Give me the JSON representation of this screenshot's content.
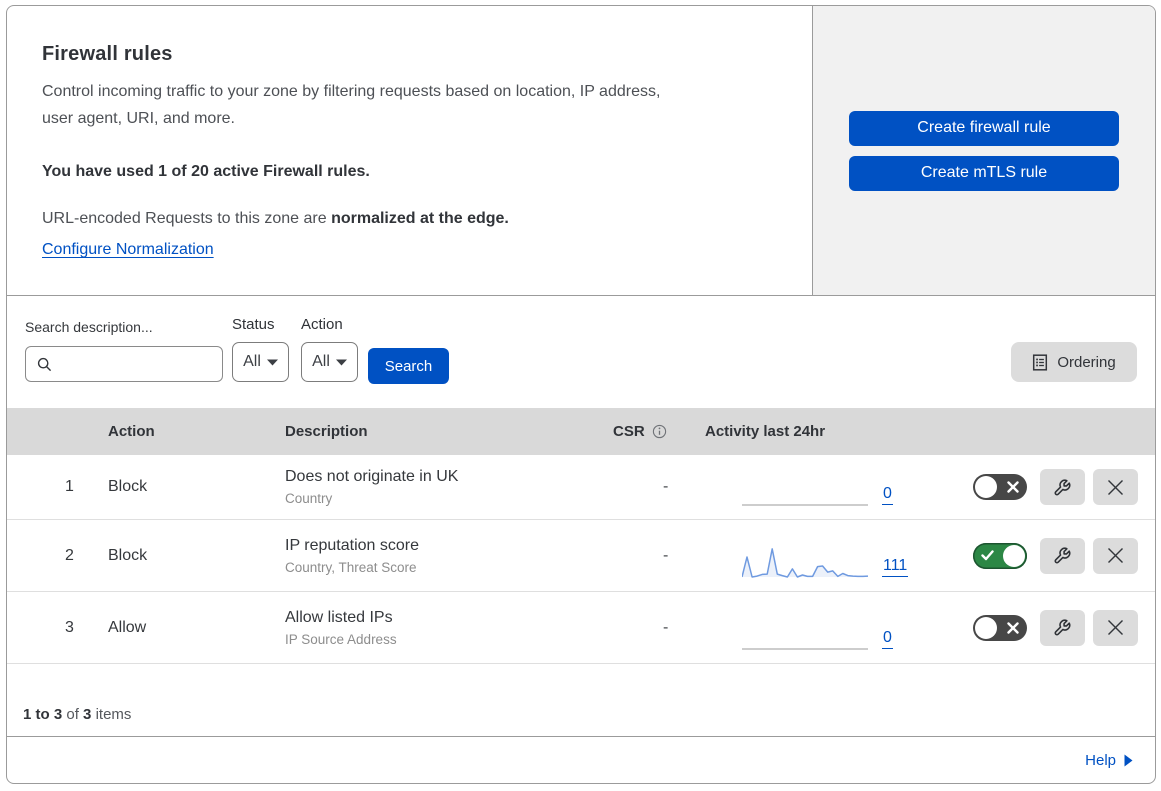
{
  "intro": {
    "title": "Firewall rules",
    "description": "Control incoming traffic to your zone by filtering requests based on location, IP address, user agent, URI, and more.",
    "usage": "You have used 1 of 20 active Firewall rules.",
    "normalization_prefix": "URL-encoded Requests to this zone are ",
    "normalization_bold": "normalized at the edge.",
    "normalization_link": "Configure Normalization"
  },
  "actions_panel": {
    "create_firewall_label": "Create firewall rule",
    "create_mtls_label": "Create mTLS rule"
  },
  "filters": {
    "search_label": "Search description...",
    "search_value": "",
    "status_label": "Status",
    "status_value": "All",
    "action_label": "Action",
    "action_value": "All",
    "search_button": "Search",
    "ordering_button": "Ordering"
  },
  "table": {
    "headers": {
      "action": "Action",
      "description": "Description",
      "csr": "CSR",
      "activity": "Activity last 24hr"
    },
    "rows": [
      {
        "num": "1",
        "action": "Block",
        "description": "Does not originate in UK",
        "fields": "Country",
        "csr": "-",
        "count": "0",
        "enabled": false,
        "sparkline": null
      },
      {
        "num": "2",
        "action": "Block",
        "description": "IP reputation score",
        "fields": "Country, Threat Score",
        "csr": "-",
        "count": "111",
        "enabled": true,
        "sparkline": [
          0,
          69,
          0,
          3,
          9,
          10,
          97,
          10,
          5,
          0,
          28,
          0,
          7,
          2,
          2,
          36,
          38,
          17,
          21,
          2,
          12,
          5,
          3,
          2,
          2,
          3
        ]
      },
      {
        "num": "3",
        "action": "Allow",
        "description": "Allow listed IPs",
        "fields": "IP Source Address",
        "csr": "-",
        "count": "0",
        "enabled": false,
        "sparkline": null
      }
    ]
  },
  "chart_data": {
    "type": "area",
    "title": "Activity last 24hr sparkline (rule 2)",
    "values": [
      0,
      69,
      0,
      3,
      9,
      10,
      97,
      10,
      5,
      0,
      28,
      0,
      7,
      2,
      2,
      36,
      38,
      17,
      21,
      2,
      12,
      5,
      3,
      2,
      2,
      3
    ],
    "ylim": [
      0,
      100
    ]
  },
  "footer": {
    "range": "1 to 3",
    "of": "of",
    "total": "3",
    "items": "items",
    "help": "Help"
  },
  "colors": {
    "accent_blue": "#0051c3",
    "panel_gray": "#f1f1f1",
    "header_gray": "#d9d9d9",
    "toggle_on_green": "#2c8745",
    "toggle_off_gray": "#474747",
    "sparkline_blue": "#6f9ae0"
  }
}
